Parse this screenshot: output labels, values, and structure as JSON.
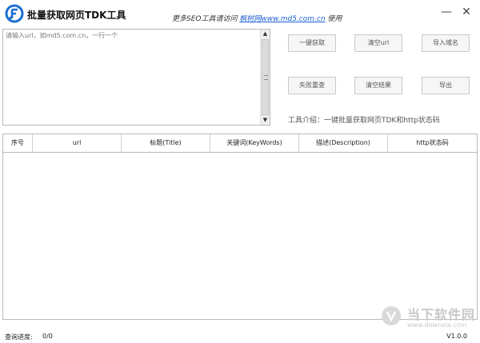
{
  "titlebar": {
    "title": "批量获取网页TDK工具",
    "promo_prefix": "更多SEO工具请访问",
    "promo_link": "枫树网www.md5.com.cn",
    "promo_suffix": "使用",
    "minimize": "—",
    "close": "✕"
  },
  "input": {
    "placeholder": "请输入url，如md5.com.cn，一行一个"
  },
  "buttons": {
    "fetch": "一键获取",
    "clear_url": "清空url",
    "import_domain": "导入域名",
    "retry_failed": "失败重查",
    "clear_results": "清空结果",
    "export": "导出"
  },
  "intro": "工具介绍：一键批量获取网页TDK和http状态码",
  "table": {
    "columns": [
      "序号",
      "url",
      "标题(Title)",
      "关键词(KeyWords)",
      "描述(Description)",
      "http状态码"
    ]
  },
  "status": {
    "label": "查询进度:",
    "value": "0/0",
    "version": "V1.0.0"
  },
  "watermark": {
    "text": "当下软件园",
    "url": "www.downxia.com"
  },
  "colors": {
    "accent": "#1a6fd0",
    "link": "#1a5fd0",
    "border": "#b9b9b9"
  }
}
